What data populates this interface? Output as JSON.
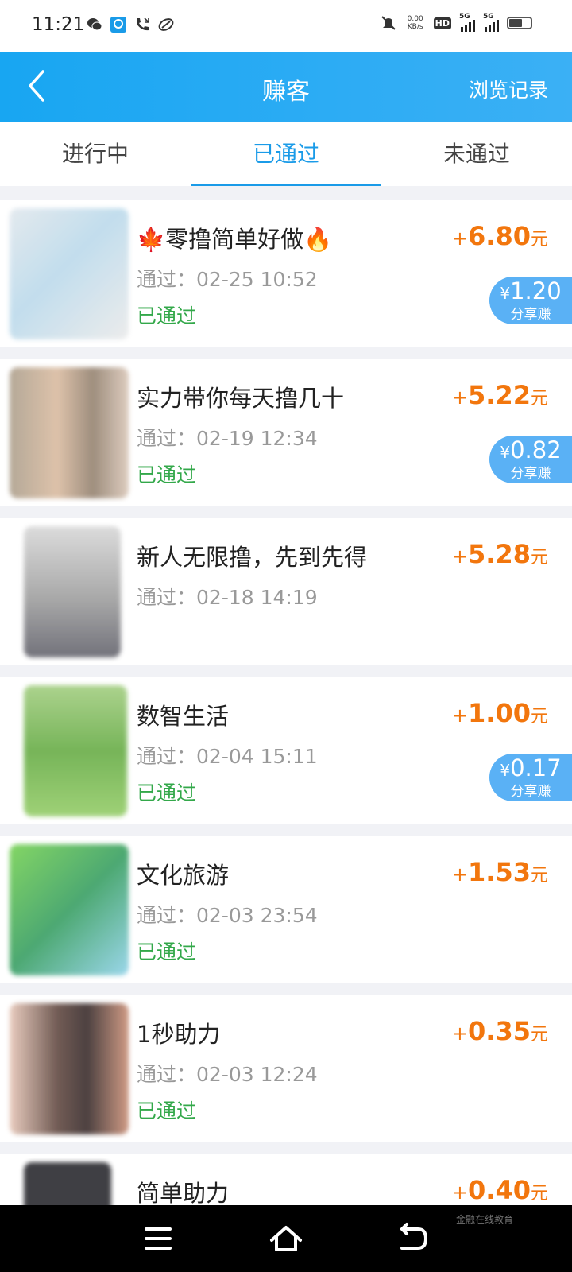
{
  "status_bar": {
    "time": "11:21",
    "net_speed_value": "0.00",
    "net_speed_unit": "KB/s",
    "hd_label": "HD",
    "sim1_label": "5G",
    "sim2_label": "5G",
    "left_icons": [
      "wechat-icon",
      "app-notification-icon",
      "missed-call-icon",
      "sync-icon"
    ],
    "right_icons": [
      "mute-icon",
      "signal-icon",
      "battery-icon"
    ]
  },
  "header": {
    "title": "赚客",
    "right_link": "浏览记录",
    "background_color": "#1ea8f2"
  },
  "tabs": [
    {
      "label": "进行中",
      "active": false
    },
    {
      "label": "已通过",
      "active": true
    },
    {
      "label": "未通过",
      "active": false
    }
  ],
  "passed_prefix": "通过：",
  "tasks": [
    {
      "title": "🍁零撸简单好做🔥",
      "time": "02-25 10:52",
      "status": "已通过",
      "reward_sign": "+",
      "reward": "6.80",
      "unit": "元",
      "share_symbol": "¥",
      "share_amount": "1.20",
      "share_label": "分享赚"
    },
    {
      "title": "实力带你每天撸几十",
      "time": "02-19 12:34",
      "status": "已通过",
      "reward_sign": "+",
      "reward": "5.22",
      "unit": "元",
      "share_symbol": "¥",
      "share_amount": "0.82",
      "share_label": "分享赚"
    },
    {
      "title": "新人无限撸，先到先得",
      "time": "02-18 14:19",
      "status": "",
      "reward_sign": "+",
      "reward": "5.28",
      "unit": "元"
    },
    {
      "title": "数智生活",
      "time": "02-04 15:11",
      "status": "已通过",
      "reward_sign": "+",
      "reward": "1.00",
      "unit": "元",
      "share_symbol": "¥",
      "share_amount": "0.17",
      "share_label": "分享赚"
    },
    {
      "title": "文化旅游",
      "time": "02-03 23:54",
      "status": "已通过",
      "reward_sign": "+",
      "reward": "1.53",
      "unit": "元"
    },
    {
      "title": "1秒助力",
      "time": "02-03 12:24",
      "status": "已通过",
      "reward_sign": "+",
      "reward": "0.35",
      "unit": "元"
    },
    {
      "title": "简单助力",
      "time": "",
      "status": "",
      "reward_sign": "+",
      "reward": "0.40",
      "unit": "元"
    }
  ],
  "watermark": "金融在线教育",
  "colors": {
    "reward": "#f2760d",
    "passed_status": "#33a84a",
    "active_tab": "#1a9be8",
    "share_badge": "#5ab1f5"
  }
}
